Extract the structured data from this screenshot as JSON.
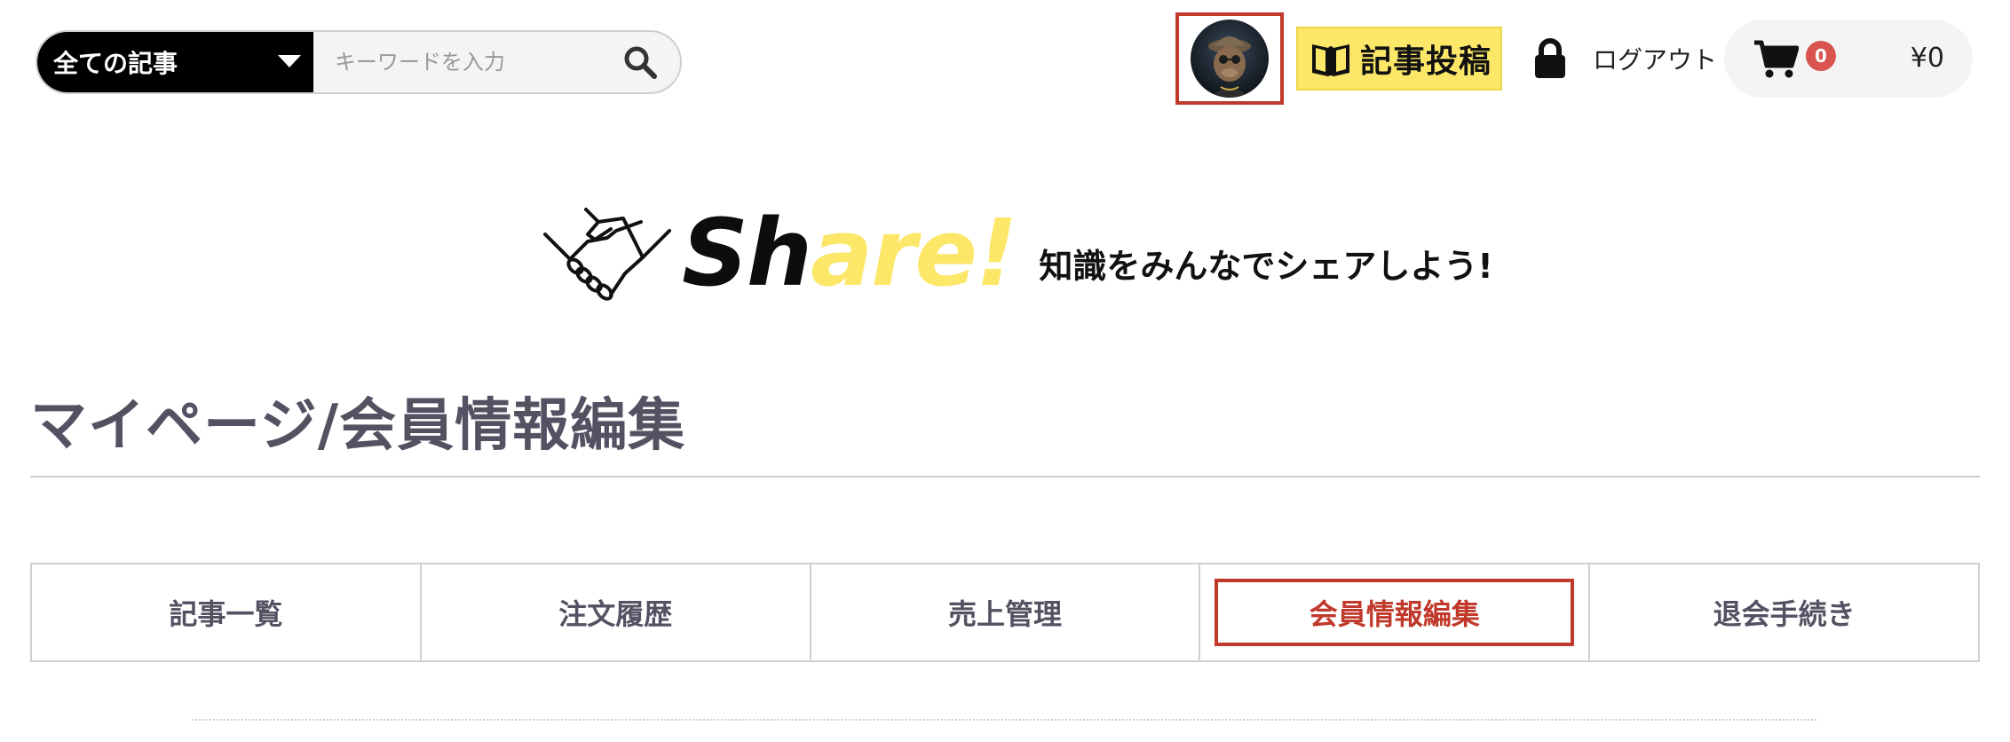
{
  "header": {
    "category_select": {
      "label": "全ての記事"
    },
    "search": {
      "placeholder": "キーワードを入力"
    },
    "post_button_label": "記事投稿",
    "logout_label": "ログアウト",
    "cart": {
      "count": "0",
      "total": "¥0"
    }
  },
  "brand": {
    "logo_dark": "Sh",
    "logo_light": "are!",
    "tagline": "知識をみんなでシェアしよう!"
  },
  "page": {
    "title": "マイページ/会員情報編集"
  },
  "tabs": [
    {
      "label": "記事一覧",
      "active": false
    },
    {
      "label": "注文履歴",
      "active": false
    },
    {
      "label": "売上管理",
      "active": false
    },
    {
      "label": "会員情報編集",
      "active": true
    },
    {
      "label": "退会手続き",
      "active": false
    }
  ],
  "colors": {
    "accent_red": "#c0392b",
    "brand_yellow": "#fde768",
    "text": "#525263"
  },
  "icons": [
    "chevron-down-icon",
    "search-icon",
    "book-icon",
    "lock-icon",
    "cart-icon",
    "handshake-icon"
  ]
}
